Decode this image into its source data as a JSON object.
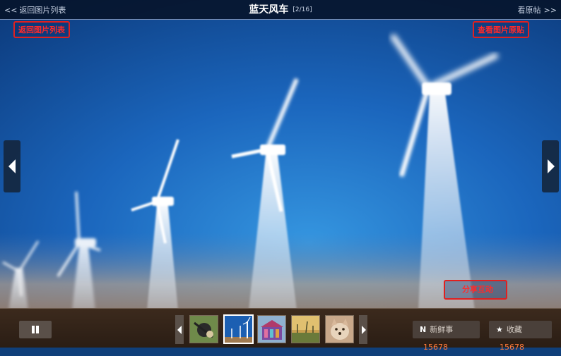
{
  "header": {
    "back_label": "返回图片列表",
    "title": "蓝天风车",
    "counter": "[2/16]",
    "original_label": "看原帖",
    "chevron_left": "<<",
    "chevron_right": ">>"
  },
  "annotations": {
    "back": "返回图片列表",
    "original": "查看图片原贴",
    "share": "分享互动"
  },
  "photo": {
    "subject": "wind turbines against blue sky",
    "sky_colors": [
      "#0d3f86",
      "#1a63b8",
      "#2b86d4"
    ],
    "ground_color": "#9a6a44"
  },
  "footer": {
    "thumbnails": [
      {
        "name": "thumb-1",
        "active": false
      },
      {
        "name": "thumb-2",
        "active": true
      },
      {
        "name": "thumb-3",
        "active": false
      },
      {
        "name": "thumb-4",
        "active": false
      },
      {
        "name": "thumb-5",
        "active": false
      }
    ],
    "actions": {
      "fresh_label": "新鲜事",
      "fresh_icon": "N",
      "fresh_count": "15678",
      "fav_label": "收藏",
      "fav_icon": "★",
      "fav_count": "15678"
    }
  },
  "colors": {
    "annotation_red": "#e02020",
    "count_orange": "#ff7a3a"
  }
}
